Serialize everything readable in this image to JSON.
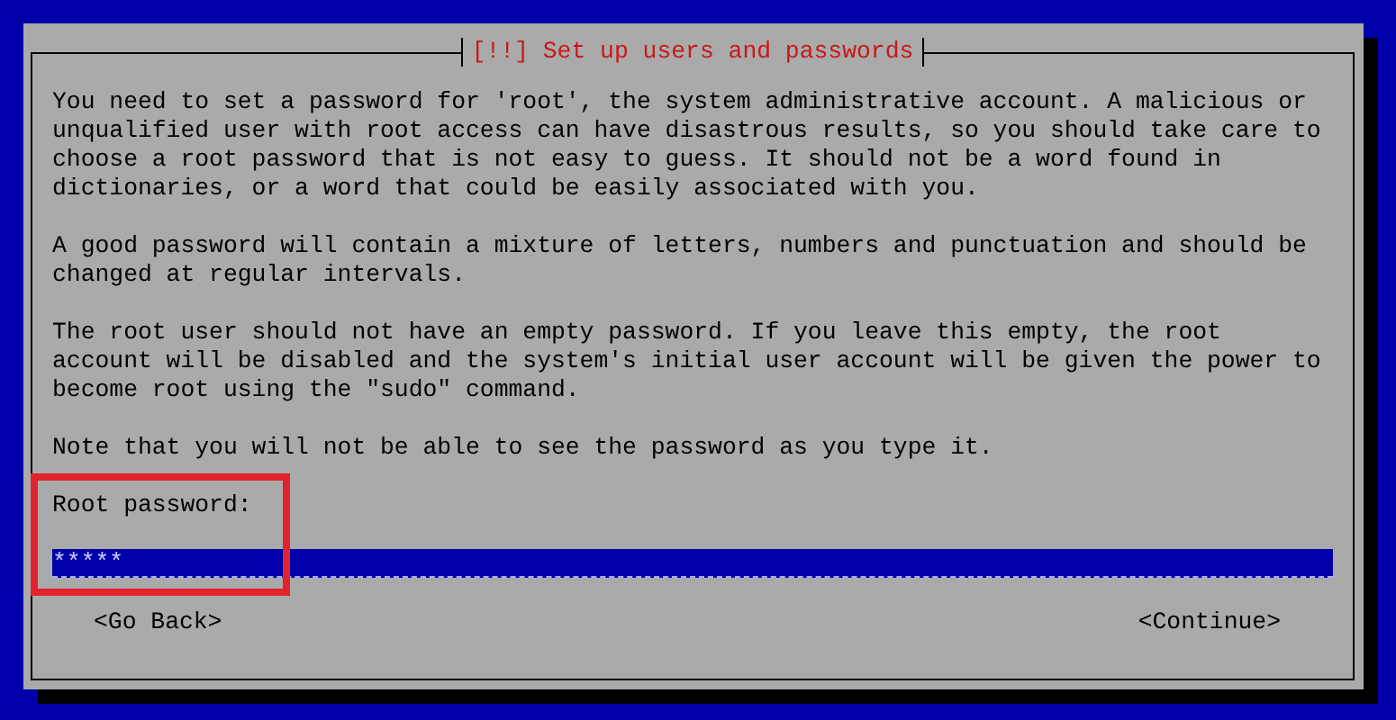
{
  "dialog": {
    "title": "[!!] Set up users and passwords",
    "paragraphs": [
      "You need to set a password for 'root', the system administrative account. A malicious or\nunqualified user with root access can have disastrous results, so you should take care to\nchoose a root password that is not easy to guess. It should not be a word found in\ndictionaries, or a word that could be easily associated with you.",
      "A good password will contain a mixture of letters, numbers and punctuation and should be\nchanged at regular intervals.",
      "The root user should not have an empty password. If you leave this empty, the root\naccount will be disabled and the system's initial user account will be given the power to\nbecome root using the \"sudo\" command.",
      "Note that you will not be able to see the password as you type it."
    ],
    "field": {
      "label": "Root password:",
      "value": "*****"
    },
    "buttons": [
      {
        "label": "<Go Back>"
      },
      {
        "label": "<Continue>"
      }
    ]
  }
}
